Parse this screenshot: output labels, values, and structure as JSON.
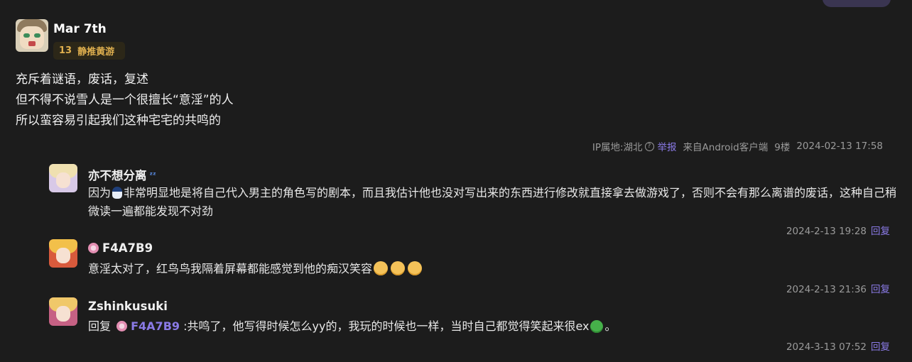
{
  "main_post": {
    "username": "Mar 7th",
    "badge_level": "13",
    "badge_name": "静推黄游",
    "lines": [
      "充斥着谜语，废话，复述",
      "但不得不说雪人是一个很擅长“意淫”的人",
      "所以蛮容易引起我们这种宅宅的共鸣的"
    ],
    "ip": "IP属地:湖北",
    "report": "举报",
    "source": "来自Android客户端",
    "floor": "9楼",
    "time": "2024-02-13 17:58"
  },
  "replies": [
    {
      "username": "亦不想分离",
      "text_before": "因为",
      "text_after": "非常明显地是将自己代入男主的角色写的剧本，而且我估计他也没对写出来的东西进行修改就直接拿去做游戏了，否则不会有那么离谱的废话，这种自己稍微读一遍都能发现不对劲",
      "time": "2024-2-13 19:28",
      "reply_label": "回复"
    },
    {
      "username": "F4A7B9",
      "text": "意淫太对了，红鸟鸟我隔着屏幕都能感觉到他的痴汉笑容",
      "time": "2024-2-13 21:36",
      "reply_label": "回复"
    },
    {
      "username": "Zshinkusuki",
      "reply_prefix": "回复",
      "mention": "F4A7B9",
      "text": ":共鸣了，他写得时候怎么yy的，我玩的时候也一样，当时自己都觉得笑起来很ex",
      "text_end": "。",
      "time": "2024-3-13 07:52",
      "reply_label": "回复"
    }
  ],
  "colors": {
    "background": "#1c1c1c",
    "accent": "#8a7ae6",
    "badge_text": "#e0b04f",
    "meta": "#9a9a9a"
  }
}
